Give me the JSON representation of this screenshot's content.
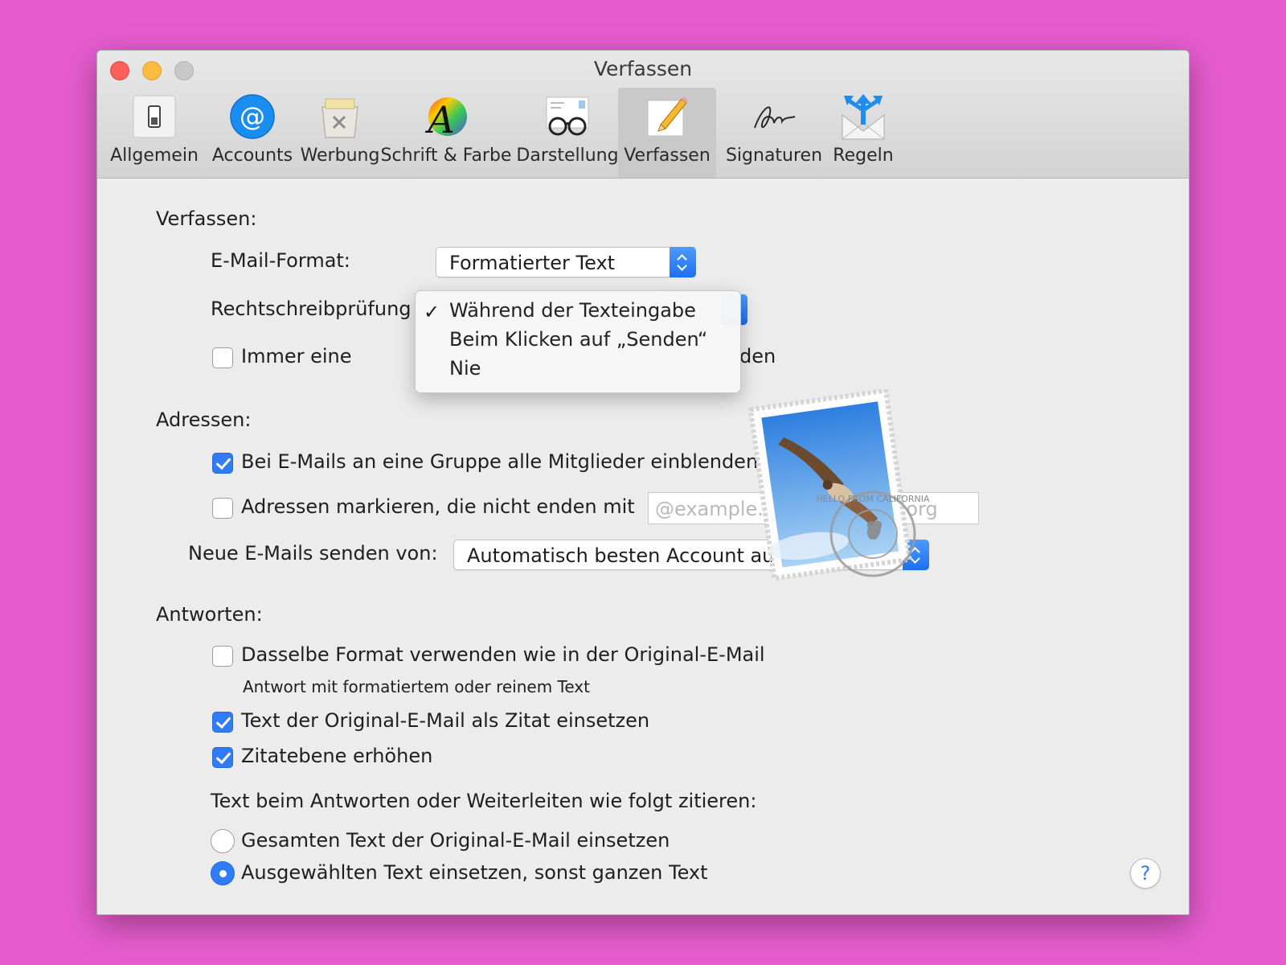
{
  "window": {
    "title": "Verfassen"
  },
  "toolbar": {
    "tabs": [
      {
        "label": "Allgemein",
        "icon": "switch-icon"
      },
      {
        "label": "Accounts",
        "icon": "at-icon"
      },
      {
        "label": "Werbung",
        "icon": "junk-bin-icon"
      },
      {
        "label": "Schrift & Farbe",
        "icon": "font-color-icon"
      },
      {
        "label": "Darstellung",
        "icon": "glasses-icon"
      },
      {
        "label": "Verfassen",
        "icon": "compose-icon",
        "selected": true
      },
      {
        "label": "Signaturen",
        "icon": "signature-icon"
      },
      {
        "label": "Regeln",
        "icon": "rules-icon"
      }
    ]
  },
  "compose": {
    "heading": "Verfassen:",
    "email_format_label": "E-Mail-Format:",
    "email_format_value": "Formatierter Text",
    "spellcheck_label": "Rechtschreibprüfung",
    "always_label_start": "Immer eine",
    "always_label_end": "den",
    "always_checked": false
  },
  "spellcheck_menu": {
    "items": [
      {
        "label": "Während der Texteingabe",
        "checked": true
      },
      {
        "label": "Beim Klicken auf „Senden“",
        "checked": false
      },
      {
        "label": "Nie",
        "checked": false
      }
    ],
    "checkmark": "✓"
  },
  "addresses": {
    "heading": "Adressen:",
    "show_group_members_label": "Bei E-Mails an eine Gruppe alle Mitglieder einblenden",
    "show_group_members_checked": true,
    "mark_addresses_label": "Adressen markieren, die nicht enden mit",
    "mark_addresses_checked": false,
    "mark_addresses_placeholder": "@example.com, example.org",
    "send_from_label": "Neue E-Mails senden von:",
    "send_from_value": "Automatisch besten Account auswählen"
  },
  "replies": {
    "heading": "Antworten:",
    "same_format_label": "Dasselbe Format verwenden wie in der Original-E-Mail",
    "same_format_checked": false,
    "same_format_hint": "Antwort mit formatiertem oder reinem Text",
    "quote_original_label": "Text der Original-E-Mail als Zitat einsetzen",
    "quote_original_checked": true,
    "increase_quote_label": "Zitatebene erhöhen",
    "increase_quote_checked": true,
    "quote_mode_heading": "Text beim Antworten oder Weiterleiten wie folgt zitieren:",
    "quote_all_label": "Gesamten Text der Original-E-Mail einsetzen",
    "quote_selected_label": "Ausgewählten Text einsetzen, sonst ganzen Text",
    "selected_option": "quote_selected"
  },
  "help": {
    "label": "?"
  },
  "stamp": {
    "icon": "mail-stamp-icon",
    "text": "HELLO FROM CALIFORNIA"
  },
  "colors": {
    "accent": "#2f7cf6",
    "background": "#e65ccf",
    "window": "#ececec"
  }
}
